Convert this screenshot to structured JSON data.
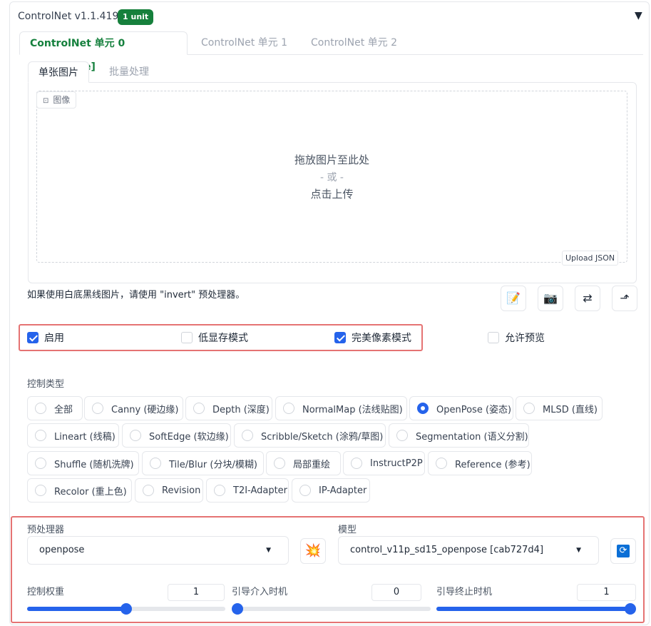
{
  "header": {
    "title": "ControlNet v1.1.419",
    "badge": "1 unit"
  },
  "unit_tabs": [
    "ControlNet 单元 0 [OpenPose]",
    "ControlNet 单元 1",
    "ControlNet 单元 2"
  ],
  "image_tabs": [
    "单张图片",
    "批量处理"
  ],
  "image_input": {
    "label": "图像",
    "drop_text": "拖放图片至此处",
    "or_text": "- 或 -",
    "click_text": "点击上传",
    "upload_json": "Upload JSON"
  },
  "hint": "如果使用白底黑线图片，请使用 \"invert\" 预处理器。",
  "options": {
    "enable": {
      "label": "启用",
      "checked": true
    },
    "low_vram": {
      "label": "低显存模式",
      "checked": false
    },
    "pixel_perfect": {
      "label": "完美像素模式",
      "checked": true
    },
    "allow_preview": {
      "label": "允许预览",
      "checked": false
    }
  },
  "control_type": {
    "label": "控制类型",
    "selected": "OpenPose (姿态)",
    "rows": [
      [
        "全部",
        "Canny (硬边缘)",
        "Depth (深度)",
        "NormalMap (法线贴图)",
        "OpenPose (姿态)",
        "MLSD (直线)"
      ],
      [
        "Lineart (线稿)",
        "SoftEdge (软边缘)",
        "Scribble/Sketch (涂鸦/草图)",
        "Segmentation (语义分割)"
      ],
      [
        "Shuffle (随机洗牌)",
        "Tile/Blur (分块/模糊)",
        "局部重绘",
        "InstructP2P",
        "Reference (参考)"
      ],
      [
        "Recolor (重上色)",
        "Revision",
        "T2I-Adapter",
        "IP-Adapter"
      ]
    ]
  },
  "preprocessor": {
    "label": "预处理器",
    "value": "openpose"
  },
  "model": {
    "label": "模型",
    "value": "control_v11p_sd15_openpose [cab727d4]"
  },
  "sliders": {
    "weight": {
      "label": "控制权重",
      "value": "1",
      "fraction": 0.5
    },
    "start": {
      "label": "引导介入时机",
      "value": "0",
      "fraction": 0.0
    },
    "end": {
      "label": "引导终止时机",
      "value": "1",
      "fraction": 1.0
    }
  },
  "colors": {
    "accent": "#2563eb",
    "active_tab": "#15803d",
    "badge": "#16803c",
    "highlight_box": "#e57373"
  }
}
